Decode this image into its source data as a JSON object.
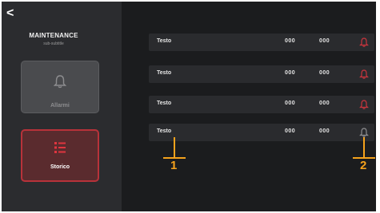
{
  "sidebar": {
    "back_label": "<",
    "title": "MAINTENANCE",
    "subtitle": "sub-subtitle",
    "alarms_label": "Allarmi",
    "history_label": "Storico"
  },
  "list": {
    "rows": [
      {
        "name": "Testo",
        "v1": "000",
        "v2": "000"
      },
      {
        "name": "Testo",
        "v1": "000",
        "v2": "000"
      },
      {
        "name": "Testo",
        "v1": "000",
        "v2": "000"
      },
      {
        "name": "Testo",
        "v1": "000",
        "v2": "000"
      }
    ]
  },
  "callouts": {
    "one": "1",
    "two": "2"
  },
  "colors": {
    "accent": "#f5a21c",
    "alert": "#c8353d",
    "background": "#1b1c1e",
    "sidebar": "#2b2c2f"
  }
}
